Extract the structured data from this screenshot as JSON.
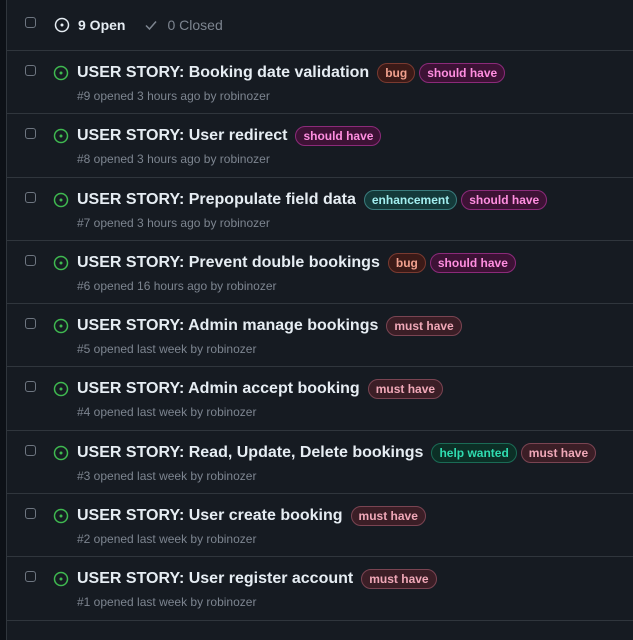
{
  "header": {
    "open_label": "9 Open",
    "closed_label": "0 Closed"
  },
  "labels": {
    "bug": {
      "text": "bug",
      "color": "#f0a08e",
      "bg": "#3b1a17",
      "border": "#7a3a30"
    },
    "should_have": {
      "text": "should have",
      "color": "#ff8ee0",
      "bg": "#3d1235",
      "border": "#8c2a7a"
    },
    "enhancement": {
      "text": "enhancement",
      "color": "#a2eeef",
      "bg": "#143a3a",
      "border": "#3a7c7d"
    },
    "must_have": {
      "text": "must have",
      "color": "#f0a8b8",
      "bg": "#3b1e26",
      "border": "#7a4452"
    },
    "help_wanted": {
      "text": "help wanted",
      "color": "#2fdcb0",
      "bg": "#0c2f26",
      "border": "#1a6b55"
    }
  },
  "issues": [
    {
      "title": "USER STORY: Booking date validation",
      "labels": [
        "bug",
        "should_have"
      ],
      "meta": "#9 opened 3 hours ago by ",
      "author": "robinozer"
    },
    {
      "title": "USER STORY: User redirect",
      "labels": [
        "should_have"
      ],
      "meta": "#8 opened 3 hours ago by ",
      "author": "robinozer"
    },
    {
      "title": "USER STORY: Prepopulate field data",
      "labels": [
        "enhancement",
        "should_have"
      ],
      "meta": "#7 opened 3 hours ago by ",
      "author": "robinozer"
    },
    {
      "title": "USER STORY: Prevent double bookings",
      "labels": [
        "bug",
        "should_have"
      ],
      "meta": "#6 opened 16 hours ago by ",
      "author": "robinozer"
    },
    {
      "title": "USER STORY: Admin manage bookings",
      "labels": [
        "must_have"
      ],
      "meta": "#5 opened last week by ",
      "author": "robinozer"
    },
    {
      "title": "USER STORY: Admin accept booking",
      "labels": [
        "must_have"
      ],
      "meta": "#4 opened last week by ",
      "author": "robinozer"
    },
    {
      "title": "USER STORY: Read, Update, Delete bookings",
      "labels": [
        "help_wanted",
        "must_have"
      ],
      "meta": "#3 opened last week by ",
      "author": "robinozer"
    },
    {
      "title": "USER STORY: User create booking",
      "labels": [
        "must_have"
      ],
      "meta": "#2 opened last week by ",
      "author": "robinozer"
    },
    {
      "title": "USER STORY: User register account",
      "labels": [
        "must_have"
      ],
      "meta": "#1 opened last week by ",
      "author": "robinozer"
    }
  ],
  "colors": {
    "open_icon": "#3fb950",
    "background": "#161b22",
    "border": "#30363d"
  }
}
